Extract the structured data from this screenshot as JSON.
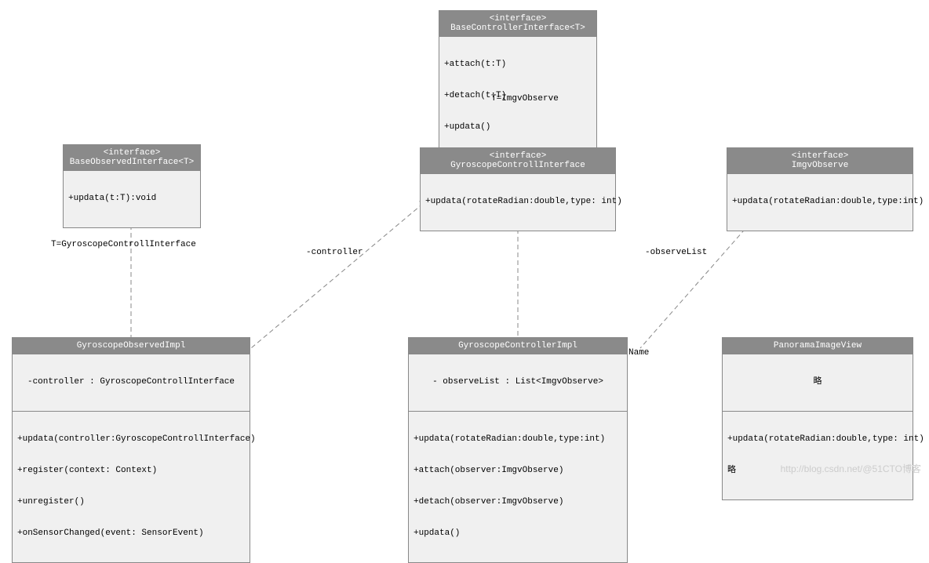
{
  "boxes": {
    "baseController": {
      "stereo": "<interface>",
      "name": "BaseControllerInterface<T>",
      "methods": [
        "+attach(t:T)",
        "+detach(t:T)",
        "+updata()"
      ]
    },
    "baseObserved": {
      "stereo": "<interface>",
      "name": "BaseObservedInterface<T>",
      "methods": [
        "+updata(t:T):void"
      ]
    },
    "gyroControllInterface": {
      "stereo": "<interface>",
      "name": "GyroscopeControllInterface",
      "methods": [
        "+updata(rotateRadian:double,type: int)"
      ]
    },
    "imgvObserve": {
      "stereo": "<interface>",
      "name": "ImgvObserve",
      "methods": [
        "+updata(rotateRadian:double,type:int)"
      ]
    },
    "gyroObservedImpl": {
      "name": "GyroscopeObservedImpl",
      "attrs": [
        "-controller : GyroscopeControllInterface"
      ],
      "methods": [
        "+updata(controller:GyroscopeControllInterface)",
        "+register(context: Context)",
        "+unregister()",
        "+onSensorChanged(event: SensorEvent)"
      ]
    },
    "gyroControllerImpl": {
      "name": "GyroscopeControllerImpl",
      "attrs": [
        "- observeList : List<ImgvObserve>"
      ],
      "methods": [
        "+updata(rotateRadian:double,type:int)",
        "+attach(observer:ImgvObserve)",
        "+detach(observer:ImgvObserve)",
        "+updata()"
      ],
      "note": "Name"
    },
    "panorama": {
      "name": "PanoramaImageView",
      "attrs": [
        "略"
      ],
      "methods": [
        "+updata(rotateRadian:double,type: int)",
        "略"
      ]
    }
  },
  "labels": {
    "t_imgv": "T=ImgvObserve",
    "t_gyro": "T=GyroscopeControllInterface",
    "controller": "-controller",
    "observeList": "-observeList"
  },
  "watermark": "http://blog.csdn.net/@51CTO博客"
}
